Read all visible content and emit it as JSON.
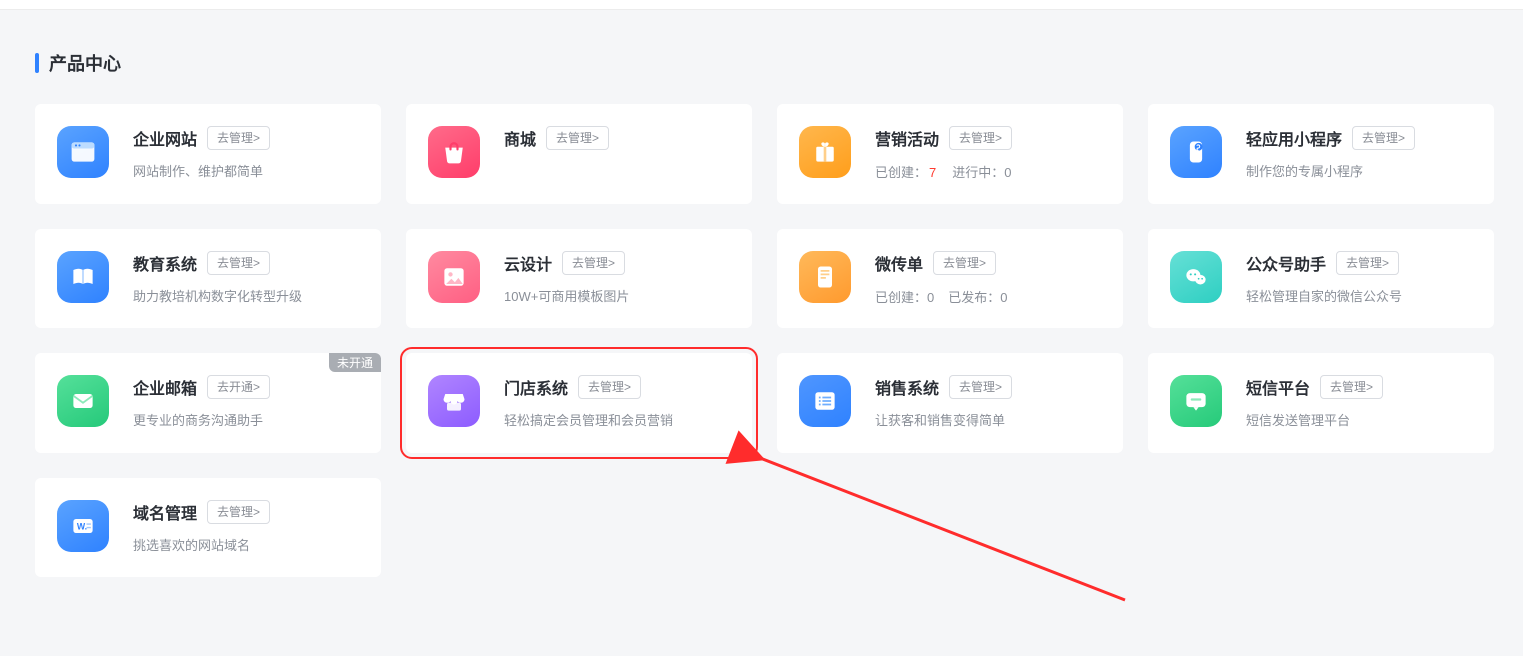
{
  "section_title": "产品中心",
  "badge_not_activated": "未开通",
  "btn_manage": "去管理>",
  "btn_activate": "去开通>",
  "cards": {
    "website": {
      "title": "企业网站",
      "desc": "网站制作、维护都简单"
    },
    "shop": {
      "title": "商城"
    },
    "marketing": {
      "title": "营销活动",
      "stat1_label": "已创建：",
      "stat1_value": "7",
      "stat2_label": "进行中：",
      "stat2_value": "0"
    },
    "miniapp": {
      "title": "轻应用小程序",
      "desc": "制作您的专属小程序"
    },
    "edu": {
      "title": "教育系统",
      "desc": "助力教培机构数字化转型升级"
    },
    "design": {
      "title": "云设计",
      "desc": "10W+可商用模板图片"
    },
    "flyer": {
      "title": "微传单",
      "stat1_label": "已创建：",
      "stat1_value": "0",
      "stat2_label": "已发布：",
      "stat2_value": "0"
    },
    "wechat": {
      "title": "公众号助手",
      "desc": "轻松管理自家的微信公众号"
    },
    "mail": {
      "title": "企业邮箱",
      "desc": "更专业的商务沟通助手"
    },
    "store": {
      "title": "门店系统",
      "desc": "轻松搞定会员管理和会员营销"
    },
    "sales": {
      "title": "销售系统",
      "desc": "让获客和销售变得简单"
    },
    "sms": {
      "title": "短信平台",
      "desc": "短信发送管理平台"
    },
    "domain": {
      "title": "域名管理",
      "desc": "挑选喜欢的网站域名"
    }
  }
}
